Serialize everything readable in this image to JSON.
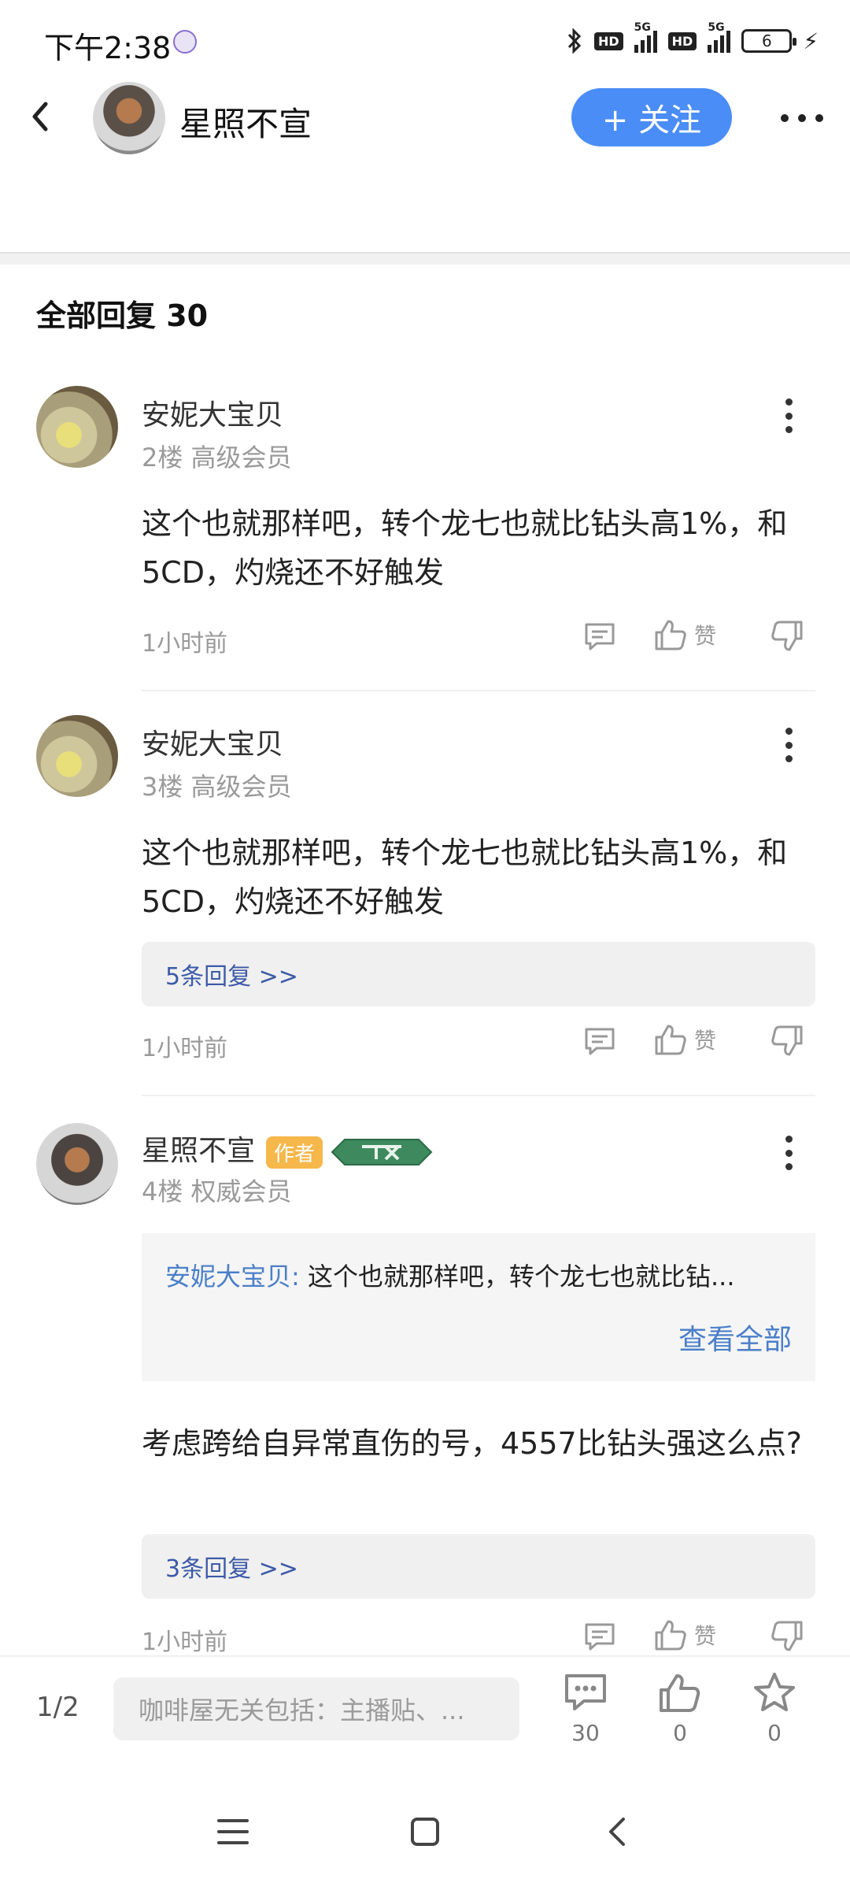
{
  "status_bar": {
    "time": "下午2:38",
    "hd1": "HD",
    "net1": "5G",
    "hd2": "HD",
    "net2": "5G",
    "battery": "6"
  },
  "header": {
    "author_name": "星照不宣",
    "follow_label": "+ 关注"
  },
  "section": {
    "title": "全部回复  30"
  },
  "comments": [
    {
      "name": "安妮大宝贝",
      "meta": "2楼  高级会员",
      "text": "这个也就那样吧，转个龙七也就比钻头高1%，和5CD，灼烧还不好触发",
      "time": "1小时前",
      "like_label": "赞"
    },
    {
      "name": "安妮大宝贝",
      "meta": "3楼  高级会员",
      "text": "这个也就那样吧，转个龙七也就比钻头高1%，和5CD，灼烧还不好触发",
      "replies": "5条回复 >>",
      "time": "1小时前",
      "like_label": "赞"
    },
    {
      "name": "星照不宣",
      "author_tag": "作者",
      "meta": "4楼  权威会员",
      "quote_name": "安妮大宝贝:",
      "quote_text": " 这个也就那样吧，转个龙七也就比钻...",
      "quote_more": "查看全部",
      "text": "考虑跨给自异常直伤的号，4557比钻头强这么点?",
      "replies": "3条回复 >>",
      "time": "1小时前",
      "like_label": "赞"
    }
  ],
  "bottom_bar": {
    "page": "1/2",
    "input_placeholder": "咖啡屋无关包括：主播贴、...",
    "comment_count": "30",
    "like_count": "0",
    "star_count": "0"
  },
  "colors": {
    "accent": "#4a8df6",
    "link": "#4a7fc9",
    "author_tag": "#f6b84b"
  }
}
